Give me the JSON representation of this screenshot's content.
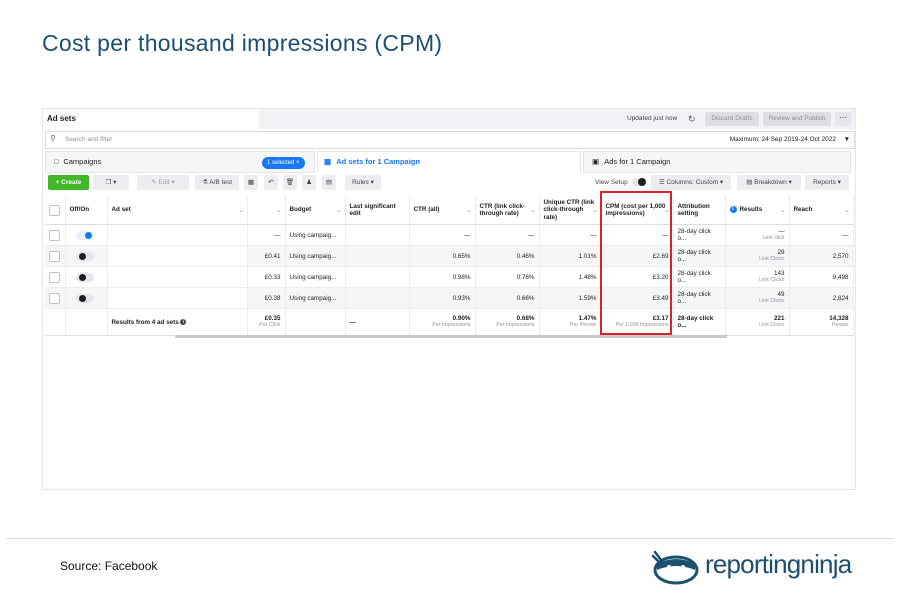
{
  "slide_title": "Cost per thousand impressions (CPM)",
  "source": "Source: Facebook",
  "logo_text": "reportingninja",
  "colors": {
    "brand": "#1d4f6e",
    "accent": "#1877f2",
    "highlight": "#d8232a",
    "create_green": "#42b72a"
  },
  "topbar": {
    "tab": "Ad sets",
    "updated": "Updated just now",
    "discard": "Discard Drafts",
    "review": "Review and Publish",
    "more": "···"
  },
  "search": {
    "placeholder": "Search and filter",
    "date_range": "Maximum: 24 Sep 2019-24 Oct 2022"
  },
  "tabs": {
    "campaigns": "Campaigns",
    "selected_pill": "1 selected ×",
    "adsets": "Ad sets for 1 Campaign",
    "ads": "Ads for 1 Campaign"
  },
  "toolbar": {
    "create": "+ Create",
    "edit": "Edit",
    "ab_test": "A/B test",
    "rules": "Rules",
    "view_setup": "View Setup",
    "columns": "Columns: Custom",
    "breakdown": "Breakdown",
    "reports": "Reports"
  },
  "table": {
    "headers": {
      "off_on": "Off/On",
      "ad_set": "Ad set",
      "budget": "Budget",
      "last_edit": "Last significant edit",
      "ctr_all": "CTR (all)",
      "ctr_link": "CTR (link click-through rate)",
      "unique_ctr": "Unique CTR (link click-through rate)",
      "cpm": "CPM (cost per 1,000 impressions)",
      "attribution": "Attribution setting",
      "results": "Results",
      "reach": "Reach"
    },
    "rows": [
      {
        "on": true,
        "cost": "—",
        "budget": "Using campaig...",
        "ctr_all": "—",
        "ctr_link": "—",
        "unique_ctr": "—",
        "cpm": "—",
        "attribution": "28-day click o...",
        "results": "—",
        "results_sub": "Link click",
        "reach": "—"
      },
      {
        "on": false,
        "cost": "£0.41",
        "budget": "Using campaig...",
        "ctr_all": "0.65%",
        "ctr_link": "0.46%",
        "unique_ctr": "1.01%",
        "cpm": "£2.69",
        "attribution": "28-day click o...",
        "results": "29",
        "results_sub": "Link Clicks",
        "reach": "2,570"
      },
      {
        "on": false,
        "cost": "£0.33",
        "budget": "Using campaig...",
        "ctr_all": "0.98%",
        "ctr_link": "0.76%",
        "unique_ctr": "1.48%",
        "cpm": "£3.20",
        "attribution": "28-day click o...",
        "results": "143",
        "results_sub": "Link Clicks",
        "reach": "9,498"
      },
      {
        "on": false,
        "cost": "£0.38",
        "budget": "Using campaig...",
        "ctr_all": "0.93%",
        "ctr_link": "0.66%",
        "unique_ctr": "1.59%",
        "cpm": "£3.49",
        "attribution": "28-day click o...",
        "results": "49",
        "results_sub": "Link Clicks",
        "reach": "2,824"
      }
    ],
    "totals": {
      "label": "Results from 4 ad sets",
      "cost": "£0.35",
      "cost_sub": "Per Click",
      "last_edit": "—",
      "ctr_all": "0.90%",
      "ctr_all_sub": "Per Impressions",
      "ctr_link": "0.68%",
      "ctr_link_sub": "Per Impressions",
      "unique_ctr": "1.47%",
      "unique_ctr_sub": "Per Person",
      "cpm": "£3.17",
      "cpm_sub": "Per 1,000 Impressions",
      "attribution": "28-day click o...",
      "results": "221",
      "results_sub": "Link Clicks",
      "reach": "14,328",
      "reach_sub": "People"
    }
  }
}
